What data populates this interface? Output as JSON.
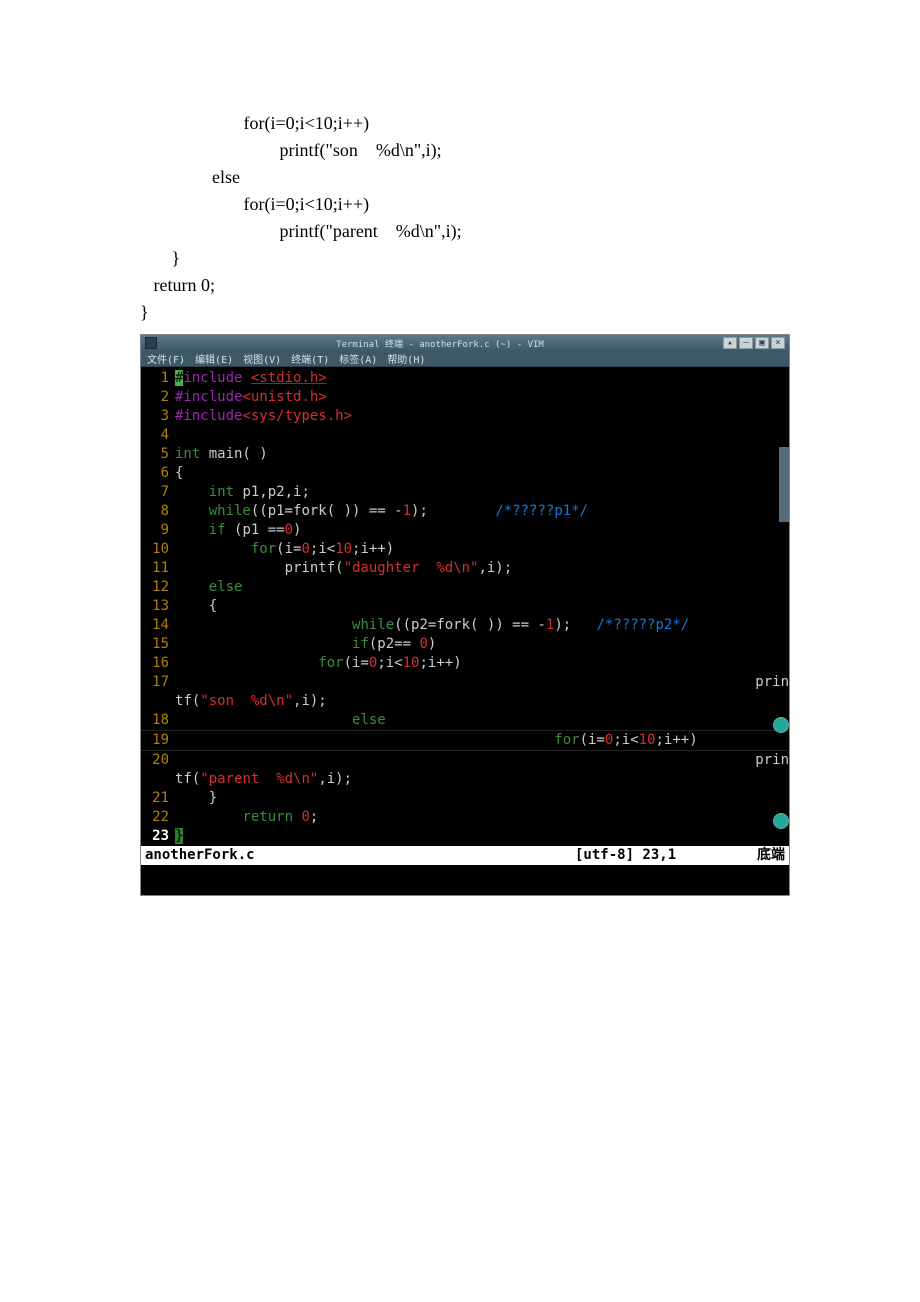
{
  "doc_snippet": "                       for(i=0;i<10;i++)\n                               printf(\"son    %d\\n\",i);\n                else\n                       for(i=0;i<10;i++)\n                               printf(\"parent    %d\\n\",i);\n       }\n   return 0;\n}",
  "window": {
    "title": "Terminal 终端 - anotherFork.c (~) - VIM"
  },
  "menu": {
    "items": [
      "文件(F)",
      "编辑(E)",
      "视图(V)",
      "终端(T)",
      "标签(A)",
      "帮助(H)"
    ]
  },
  "titlebar_buttons": [
    "▴",
    "–",
    "▣",
    "×"
  ],
  "code": {
    "lines": [
      {
        "n": 1,
        "tokens": [
          {
            "c": "cursor-block",
            "t": "#"
          },
          {
            "c": "inc",
            "t": "include "
          },
          {
            "c": "hdr und",
            "t": "<stdio.h>"
          }
        ]
      },
      {
        "n": 2,
        "tokens": [
          {
            "c": "inc",
            "t": "#include"
          },
          {
            "c": "hdr",
            "t": "<unistd.h>"
          }
        ]
      },
      {
        "n": 3,
        "tokens": [
          {
            "c": "inc",
            "t": "#include"
          },
          {
            "c": "hdr",
            "t": "<sys/types.h>"
          }
        ]
      },
      {
        "n": 4,
        "tokens": []
      },
      {
        "n": 5,
        "tokens": [
          {
            "c": "type",
            "t": "int "
          },
          {
            "c": "ident",
            "t": "main( )"
          }
        ]
      },
      {
        "n": 6,
        "tokens": [
          {
            "c": "ident",
            "t": "{"
          }
        ]
      },
      {
        "n": 7,
        "tokens": [
          {
            "c": "ident",
            "t": "    "
          },
          {
            "c": "type",
            "t": "int "
          },
          {
            "c": "ident",
            "t": "p1,p2,i;"
          }
        ]
      },
      {
        "n": 8,
        "tokens": [
          {
            "c": "ident",
            "t": "    "
          },
          {
            "c": "kw",
            "t": "while"
          },
          {
            "c": "ident",
            "t": "((p1=fork( )) == -"
          },
          {
            "c": "num",
            "t": "1"
          },
          {
            "c": "ident",
            "t": ");        "
          },
          {
            "c": "cmt",
            "t": "/*?????p1*/"
          }
        ]
      },
      {
        "n": 9,
        "tokens": [
          {
            "c": "ident",
            "t": "    "
          },
          {
            "c": "kw",
            "t": "if "
          },
          {
            "c": "ident",
            "t": "(p1 =="
          },
          {
            "c": "num",
            "t": "0"
          },
          {
            "c": "ident",
            "t": ")"
          }
        ]
      },
      {
        "n": 10,
        "tokens": [
          {
            "c": "ident",
            "t": "         "
          },
          {
            "c": "kw",
            "t": "for"
          },
          {
            "c": "ident",
            "t": "(i="
          },
          {
            "c": "num",
            "t": "0"
          },
          {
            "c": "ident",
            "t": ";i<"
          },
          {
            "c": "num",
            "t": "10"
          },
          {
            "c": "ident",
            "t": ";i++)"
          }
        ]
      },
      {
        "n": 11,
        "tokens": [
          {
            "c": "ident",
            "t": "             printf("
          },
          {
            "c": "str",
            "t": "\"daughter  %d\\n\""
          },
          {
            "c": "ident",
            "t": ",i);"
          }
        ]
      },
      {
        "n": 12,
        "tokens": [
          {
            "c": "ident",
            "t": "    "
          },
          {
            "c": "kw",
            "t": "else"
          }
        ]
      },
      {
        "n": 13,
        "tokens": [
          {
            "c": "ident",
            "t": "    {"
          }
        ]
      },
      {
        "n": 14,
        "tokens": [
          {
            "c": "ident",
            "t": "                     "
          },
          {
            "c": "kw",
            "t": "while"
          },
          {
            "c": "ident",
            "t": "((p2=fork( )) == -"
          },
          {
            "c": "num",
            "t": "1"
          },
          {
            "c": "ident",
            "t": ");   "
          },
          {
            "c": "cmt",
            "t": "/*?????p2*/"
          }
        ]
      },
      {
        "n": 15,
        "tokens": [
          {
            "c": "ident",
            "t": "                     "
          },
          {
            "c": "kw",
            "t": "if"
          },
          {
            "c": "ident",
            "t": "(p2== "
          },
          {
            "c": "num",
            "t": "0"
          },
          {
            "c": "ident",
            "t": ")"
          }
        ]
      },
      {
        "n": 16,
        "tokens": [
          {
            "c": "ident",
            "t": "                 "
          },
          {
            "c": "kw",
            "t": "for"
          },
          {
            "c": "ident",
            "t": "(i="
          },
          {
            "c": "num",
            "t": "0"
          },
          {
            "c": "ident",
            "t": ";i<"
          },
          {
            "c": "num",
            "t": "10"
          },
          {
            "c": "ident",
            "t": ";i++)"
          }
        ]
      },
      {
        "n": 17,
        "wrap_right": "prin",
        "wrap_rest_tokens": [
          {
            "c": "ident",
            "t": "tf("
          },
          {
            "c": "str",
            "t": "\"son  %d\\n\""
          },
          {
            "c": "ident",
            "t": ",i);"
          }
        ]
      },
      {
        "n": 18,
        "tokens": [
          {
            "c": "ident",
            "t": "                     "
          },
          {
            "c": "kw",
            "t": "else"
          }
        ]
      },
      {
        "n": 19,
        "hr": true,
        "tokens": [
          {
            "c": "ident",
            "t": "                                             "
          },
          {
            "c": "kw",
            "t": "for"
          },
          {
            "c": "ident",
            "t": "(i="
          },
          {
            "c": "num",
            "t": "0"
          },
          {
            "c": "ident",
            "t": ";i<"
          },
          {
            "c": "num",
            "t": "10"
          },
          {
            "c": "ident",
            "t": ";i++)"
          }
        ]
      },
      {
        "n": 20,
        "hr": true,
        "wrap_right": "prin",
        "wrap_rest_tokens": [
          {
            "c": "ident",
            "t": "tf("
          },
          {
            "c": "str",
            "t": "\"parent  %d\\n\""
          },
          {
            "c": "ident",
            "t": ",i);"
          }
        ]
      },
      {
        "n": 21,
        "tokens": [
          {
            "c": "ident",
            "t": "    }"
          }
        ]
      },
      {
        "n": 22,
        "tokens": [
          {
            "c": "ident",
            "t": "        "
          },
          {
            "c": "kw",
            "t": "return "
          },
          {
            "c": "num",
            "t": "0"
          },
          {
            "c": "ident",
            "t": ";"
          }
        ]
      },
      {
        "n": 23,
        "current": true,
        "tokens": [
          {
            "c": "brace-match",
            "t": "}"
          }
        ]
      }
    ]
  },
  "status": {
    "filename": "anotherFork.c",
    "encoding_pos": "[utf-8] 23,1",
    "scroll": "底端"
  }
}
